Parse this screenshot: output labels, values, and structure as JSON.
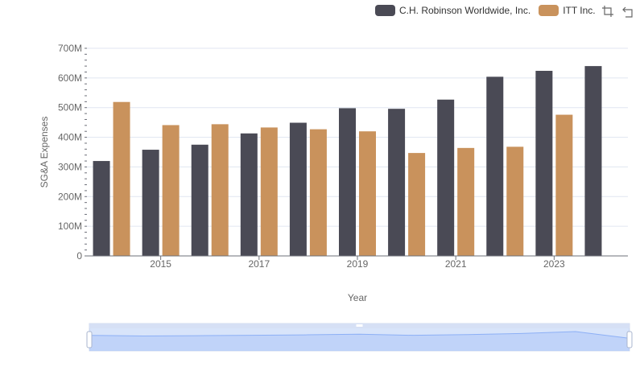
{
  "legend": {
    "items": [
      {
        "label": "C.H. Robinson Worldwide, Inc.",
        "color": "#4a4a55"
      },
      {
        "label": "ITT Inc.",
        "color": "#c9925c"
      }
    ]
  },
  "toolbox": {
    "icons": [
      "zoom-icon",
      "restore-icon"
    ]
  },
  "chart_data": {
    "type": "bar",
    "x": [
      2014,
      2015,
      2016,
      2017,
      2018,
      2019,
      2020,
      2021,
      2022,
      2023,
      2024
    ],
    "x_tick_labels": [
      "2015",
      "2017",
      "2019",
      "2021",
      "2023"
    ],
    "series": [
      {
        "name": "C.H. Robinson Worldwide, Inc.",
        "color": "#4a4a55",
        "values": [
          320000000,
          358000000,
          375000000,
          413000000,
          449000000,
          498000000,
          496000000,
          527000000,
          604000000,
          624000000,
          640000000
        ]
      },
      {
        "name": "ITT Inc.",
        "color": "#c9925c",
        "values": [
          519000000,
          441000000,
          444000000,
          433000000,
          427000000,
          420000000,
          347000000,
          364000000,
          368000000,
          476000000,
          null
        ]
      }
    ],
    "xlabel": "Year",
    "ylabel": "SG&A Expenses",
    "ylim": [
      0,
      700000000
    ],
    "y_ticks": [
      0,
      100000000,
      200000000,
      300000000,
      400000000,
      500000000,
      600000000,
      700000000
    ],
    "y_tick_labels": [
      "0",
      "100M",
      "200M",
      "300M",
      "400M",
      "500M",
      "600M",
      "700M"
    ],
    "grid": true,
    "legend_position": "top-right",
    "data_zoom": true
  }
}
